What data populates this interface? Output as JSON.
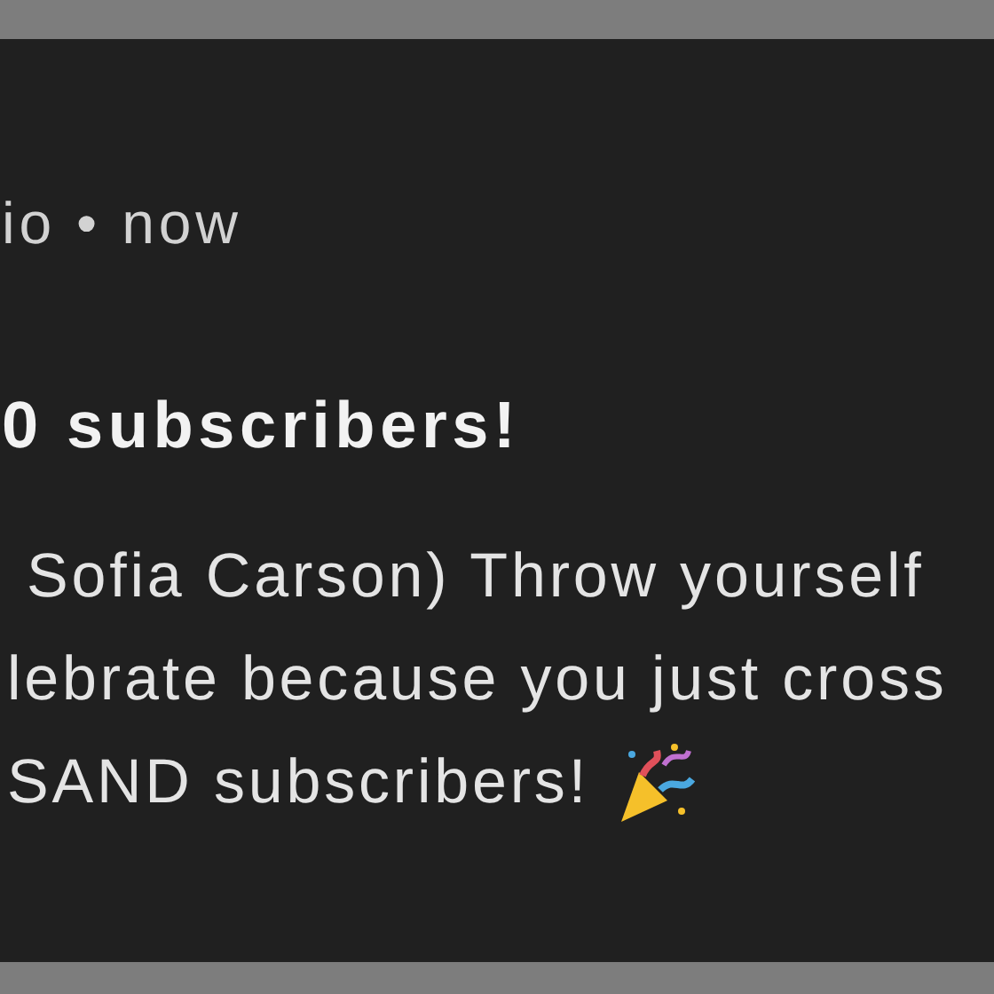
{
  "notification": {
    "meta": "io • now",
    "title": "0 subscribers!",
    "body_lines": [
      "Sofia Carson) Throw yourself",
      "lebrate because you just cross",
      "SAND subscribers!"
    ]
  }
}
